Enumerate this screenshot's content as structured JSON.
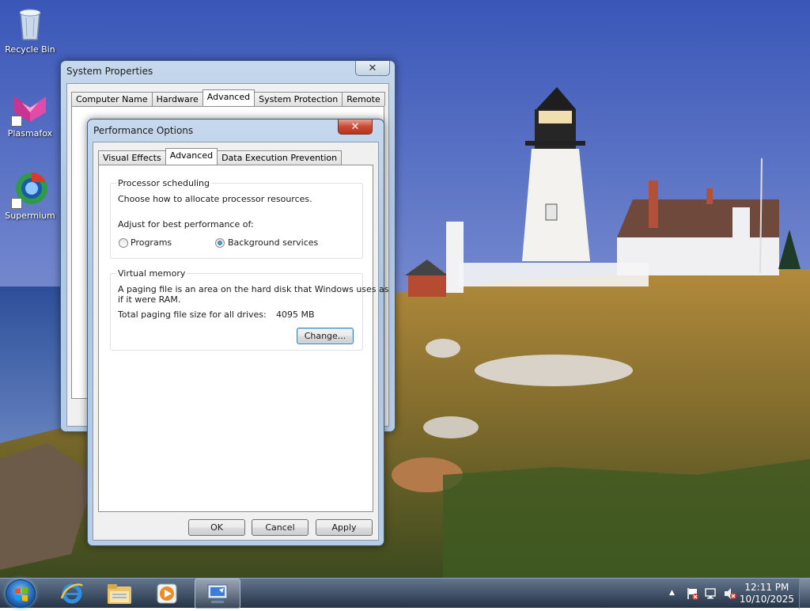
{
  "desktop": {
    "icons": [
      {
        "label": "Recycle Bin",
        "icon": "recycle-bin-icon"
      },
      {
        "label": "Plasmafox",
        "icon": "plasmafox-icon"
      },
      {
        "label": "Supermium",
        "icon": "supermium-icon"
      }
    ]
  },
  "system_properties": {
    "title": "System Properties",
    "close_label": "✕",
    "tabs": [
      "Computer Name",
      "Hardware",
      "Advanced",
      "System Protection",
      "Remote"
    ],
    "active_tab": "Advanced"
  },
  "performance_options": {
    "title": "Performance Options",
    "close_label": "✕",
    "tabs": [
      "Visual Effects",
      "Advanced",
      "Data Execution Prevention"
    ],
    "active_tab": "Advanced",
    "processor_scheduling": {
      "title": "Processor scheduling",
      "description": "Choose how to allocate processor resources.",
      "adjust_label": "Adjust for best performance of:",
      "options": [
        {
          "label": "Programs",
          "selected": false
        },
        {
          "label": "Background services",
          "selected": true
        }
      ]
    },
    "virtual_memory": {
      "title": "Virtual memory",
      "description_line1": "A paging file is an area on the hard disk that Windows uses as",
      "description_line2": "if it were RAM.",
      "total_label": "Total paging file size for all drives:",
      "total_value": "4095 MB",
      "change_button": "Change..."
    },
    "buttons": {
      "ok": "OK",
      "cancel": "Cancel",
      "apply": "Apply"
    }
  },
  "taskbar": {
    "pinned": [
      {
        "icon": "internet-explorer-icon"
      },
      {
        "icon": "file-explorer-icon"
      },
      {
        "icon": "media-player-icon"
      },
      {
        "icon": "system-properties-icon",
        "active": true
      }
    ],
    "clock": {
      "time": "12:11 PM",
      "date": "10/10/2025"
    },
    "tray_icons": [
      "show-hidden-icons-arrow-icon",
      "action-center-flag-icon",
      "network-icon",
      "volume-muted-icon"
    ]
  }
}
